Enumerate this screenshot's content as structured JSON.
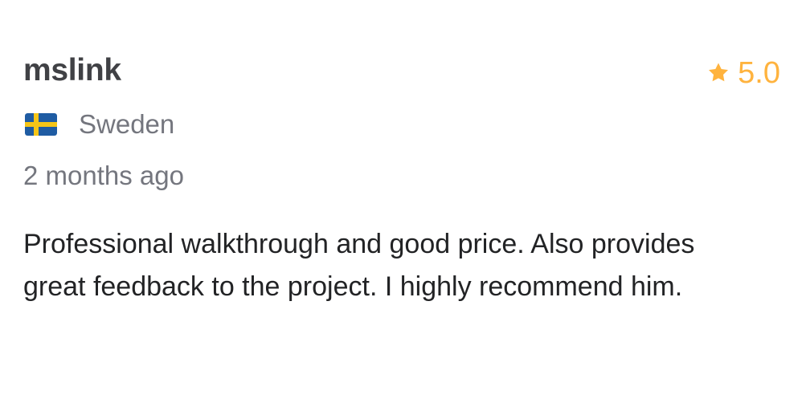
{
  "review": {
    "username": "mslink",
    "rating": "5.0",
    "country": "Sweden",
    "time_ago": "2 months ago",
    "text": "Professional walkthrough and good price. Also provides great feedback to the project. I highly recommend him."
  },
  "icons": {
    "rating": "star-icon",
    "flag": "sweden-flag-icon"
  },
  "colors": {
    "star": "#ffb33e",
    "username": "#404145",
    "muted": "#74767e",
    "body_text": "#222325",
    "flag_blue": "#1f5ca3",
    "flag_yellow": "#f5c518"
  }
}
